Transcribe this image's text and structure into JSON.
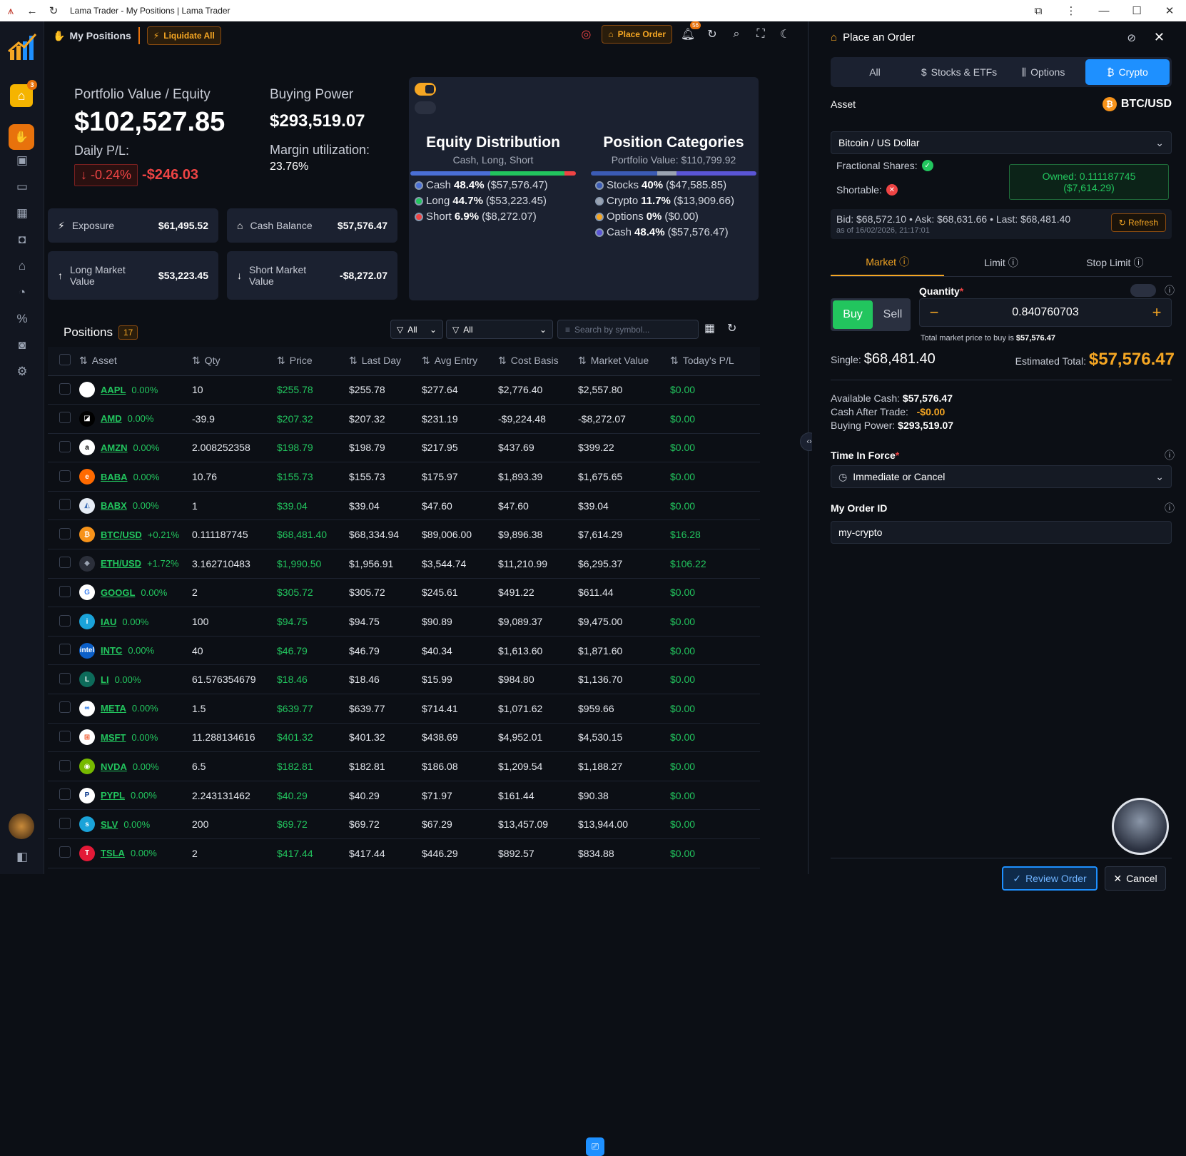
{
  "window": {
    "title": "Lama Trader - My Positions | Lama Trader"
  },
  "topbar": {
    "title": "My Positions",
    "liquidate_label": "Liquidate All",
    "place_order_label": "Place Order",
    "bell_count": "56"
  },
  "sidebar": {
    "badge_count": "3"
  },
  "summary": {
    "pv_label": "Portfolio Value / Equity",
    "pv_value": "$102,527.85",
    "daily_pl_label": "Daily P/L:",
    "daily_pl_pct": "↓ -0.24%",
    "daily_pl_amt": "-$246.03",
    "bp_label": "Buying Power",
    "bp_value": "$293,519.07",
    "margin_label": "Margin utilization:",
    "margin_value": "23.76%"
  },
  "cards": {
    "exposure": {
      "label": "Exposure",
      "value": "$61,495.52"
    },
    "cash": {
      "label": "Cash Balance",
      "value": "$57,576.47"
    },
    "long": {
      "label": "Long Market Value",
      "value": "$53,223.45"
    },
    "short": {
      "label": "Short Market Value",
      "value": "-$8,272.07"
    }
  },
  "equity_dist": {
    "title": "Equity Distribution",
    "subtitle": "Cash, Long, Short",
    "items": [
      {
        "name": "Cash",
        "pct": "48.4%",
        "amt": "($57,576.47)",
        "color": "#4a6fd6",
        "share": 0.484
      },
      {
        "name": "Long",
        "pct": "44.7%",
        "amt": "($53,223.45)",
        "color": "#22c55e",
        "share": 0.447
      },
      {
        "name": "Short",
        "pct": "6.9%",
        "amt": "($8,272.07)",
        "color": "#ef4444",
        "share": 0.069
      }
    ]
  },
  "pos_cat": {
    "title": "Position Categories",
    "subtitle": "Portfolio Value: $110,799.92",
    "items": [
      {
        "name": "Stocks",
        "pct": "40%",
        "amt": "($47,585.85)",
        "color": "#3b5bb5",
        "share": 0.4
      },
      {
        "name": "Crypto",
        "pct": "11.7%",
        "amt": "($13,909.66)",
        "color": "#9aa3b2",
        "share": 0.117
      },
      {
        "name": "Options",
        "pct": "0%",
        "amt": "($0.00)",
        "color": "#f5a623",
        "share": 0.0
      },
      {
        "name": "Cash",
        "pct": "48.4%",
        "amt": "($57,576.47)",
        "color": "#5a55d6",
        "share": 0.484
      }
    ]
  },
  "positions": {
    "title": "Positions",
    "count": "17",
    "filter1": "All",
    "filter2": "All",
    "search_placeholder": "Search by symbol...",
    "columns": [
      "Asset",
      "Qty",
      "Price",
      "Last Day",
      "Avg Entry",
      "Cost Basis",
      "Market Value",
      "Today's P/L"
    ],
    "rows": [
      {
        "sym": "AAPL",
        "pct": "0.00%",
        "qty": "10",
        "price": "$255.78",
        "last": "$255.78",
        "avg": "$277.64",
        "cost": "$2,776.40",
        "mv": "$2,557.80",
        "pl": "$0.00",
        "logo": "",
        "lc": "#ffffff",
        "lt": "#000"
      },
      {
        "sym": "AMD",
        "pct": "0.00%",
        "qty": "-39.9",
        "price": "$207.32",
        "last": "$207.32",
        "avg": "$231.19",
        "cost": "-$9,224.48",
        "mv": "-$8,272.07",
        "pl": "$0.00",
        "logo": "◪",
        "lc": "#000000",
        "lt": "#fff"
      },
      {
        "sym": "AMZN",
        "pct": "0.00%",
        "qty": "2.008252358",
        "price": "$198.79",
        "last": "$198.79",
        "avg": "$217.95",
        "cost": "$437.69",
        "mv": "$399.22",
        "pl": "$0.00",
        "logo": "a",
        "lc": "#ffffff",
        "lt": "#000"
      },
      {
        "sym": "BABA",
        "pct": "0.00%",
        "qty": "10.76",
        "price": "$155.73",
        "last": "$155.73",
        "avg": "$175.97",
        "cost": "$1,893.39",
        "mv": "$1,675.65",
        "pl": "$0.00",
        "logo": "e",
        "lc": "#ff6a00",
        "lt": "#fff"
      },
      {
        "sym": "BABX",
        "pct": "0.00%",
        "qty": "1",
        "price": "$39.04",
        "last": "$39.04",
        "avg": "$47.60",
        "cost": "$47.60",
        "mv": "$39.04",
        "pl": "$0.00",
        "logo": "◭",
        "lc": "#e6ecf5",
        "lt": "#3b6db5"
      },
      {
        "sym": "BTC/USD",
        "pct": "+0.21%",
        "qty": "0.111187745",
        "price": "$68,481.40",
        "last": "$68,334.94",
        "avg": "$89,006.00",
        "cost": "$9,896.38",
        "mv": "$7,614.29",
        "pl": "$16.28",
        "logo": "₿",
        "lc": "#f7931a",
        "lt": "#fff"
      },
      {
        "sym": "ETH/USD",
        "pct": "+1.72%",
        "qty": "3.162710483",
        "price": "$1,990.50",
        "last": "$1,956.91",
        "avg": "$3,544.74",
        "cost": "$11,210.99",
        "mv": "$6,295.37",
        "pl": "$106.22",
        "logo": "◆",
        "lc": "#2b2f3a",
        "lt": "#9aa3b2"
      },
      {
        "sym": "GOOGL",
        "pct": "0.00%",
        "qty": "2",
        "price": "$305.72",
        "last": "$305.72",
        "avg": "$245.61",
        "cost": "$491.22",
        "mv": "$611.44",
        "pl": "$0.00",
        "logo": "G",
        "lc": "#ffffff",
        "lt": "#4285f4"
      },
      {
        "sym": "IAU",
        "pct": "0.00%",
        "qty": "100",
        "price": "$94.75",
        "last": "$94.75",
        "avg": "$90.89",
        "cost": "$9,089.37",
        "mv": "$9,475.00",
        "pl": "$0.00",
        "logo": "i",
        "lc": "#1aa3d9",
        "lt": "#fff"
      },
      {
        "sym": "INTC",
        "pct": "0.00%",
        "qty": "40",
        "price": "$46.79",
        "last": "$46.79",
        "avg": "$40.34",
        "cost": "$1,613.60",
        "mv": "$1,871.60",
        "pl": "$0.00",
        "logo": "intel",
        "lc": "#0b5fc8",
        "lt": "#fff"
      },
      {
        "sym": "LI",
        "pct": "0.00%",
        "qty": "61.576354679",
        "price": "$18.46",
        "last": "$18.46",
        "avg": "$15.99",
        "cost": "$984.80",
        "mv": "$1,136.70",
        "pl": "$0.00",
        "logo": "L",
        "lc": "#0d6b5a",
        "lt": "#fff"
      },
      {
        "sym": "META",
        "pct": "0.00%",
        "qty": "1.5",
        "price": "$639.77",
        "last": "$639.77",
        "avg": "$714.41",
        "cost": "$1,071.62",
        "mv": "$959.66",
        "pl": "$0.00",
        "logo": "∞",
        "lc": "#ffffff",
        "lt": "#0a66e4"
      },
      {
        "sym": "MSFT",
        "pct": "0.00%",
        "qty": "11.288134616",
        "price": "$401.32",
        "last": "$401.32",
        "avg": "$438.69",
        "cost": "$4,952.01",
        "mv": "$4,530.15",
        "pl": "$0.00",
        "logo": "⊞",
        "lc": "#ffffff",
        "lt": "#f25022"
      },
      {
        "sym": "NVDA",
        "pct": "0.00%",
        "qty": "6.5",
        "price": "$182.81",
        "last": "$182.81",
        "avg": "$186.08",
        "cost": "$1,209.54",
        "mv": "$1,188.27",
        "pl": "$0.00",
        "logo": "◉",
        "lc": "#76b900",
        "lt": "#fff"
      },
      {
        "sym": "PYPL",
        "pct": "0.00%",
        "qty": "2.243131462",
        "price": "$40.29",
        "last": "$40.29",
        "avg": "$71.97",
        "cost": "$161.44",
        "mv": "$90.38",
        "pl": "$0.00",
        "logo": "P",
        "lc": "#ffffff",
        "lt": "#003087"
      },
      {
        "sym": "SLV",
        "pct": "0.00%",
        "qty": "200",
        "price": "$69.72",
        "last": "$69.72",
        "avg": "$67.29",
        "cost": "$13,457.09",
        "mv": "$13,944.00",
        "pl": "$0.00",
        "logo": "s",
        "lc": "#1aa3d9",
        "lt": "#fff"
      },
      {
        "sym": "TSLA",
        "pct": "0.00%",
        "qty": "2",
        "price": "$417.44",
        "last": "$417.44",
        "avg": "$446.29",
        "cost": "$892.57",
        "mv": "$834.88",
        "pl": "$0.00",
        "logo": "T",
        "lc": "#e31937",
        "lt": "#fff"
      }
    ]
  },
  "order": {
    "title": "Place an Order",
    "tabs": [
      "All",
      "Stocks & ETFs",
      "Options",
      "Crypto"
    ],
    "asset_label": "Asset",
    "asset_symbol": "BTC/USD",
    "asset_name": "Bitcoin / US Dollar",
    "fractional_label": "Fractional Shares:",
    "shortable_label": "Shortable:",
    "owned_line1": "Owned: 0.111187745",
    "owned_line2": "($7,614.29)",
    "quote_line": "Bid: $68,572.10 • Ask: $68,631.66 • Last: $68,481.40",
    "quote_time": "as of 16/02/2026, 21:17:01",
    "refresh_label": "Refresh",
    "order_types": [
      "Market",
      "Limit",
      "Stop Limit"
    ],
    "quantity_label": "Quantity",
    "buy_label": "Buy",
    "sell_label": "Sell",
    "quantity_value": "0.840760703",
    "total_note": "Total market price to buy is",
    "total_note_value": "$57,576.47",
    "single_label": "Single:",
    "single_value": "$68,481.40",
    "est_label": "Estimated Total:",
    "est_value": "$57,576.47",
    "avail_cash_label": "Available Cash:",
    "avail_cash_value": "$57,576.47",
    "cash_after_label": "Cash After Trade:",
    "cash_after_value": "-$0.00",
    "bp_label": "Buying Power:",
    "bp_value": "$293,519.07",
    "tif_label": "Time In Force",
    "tif_value": "Immediate or Cancel",
    "oid_label": "My Order ID",
    "oid_value": "my-crypto",
    "review_label": "Review Order",
    "cancel_label": "Cancel"
  }
}
